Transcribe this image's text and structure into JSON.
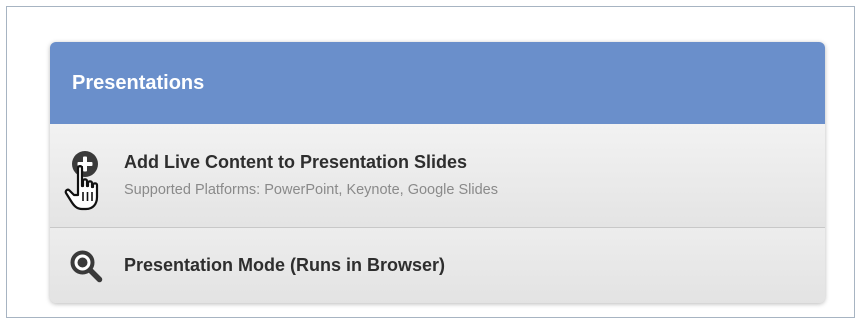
{
  "panel": {
    "title": "Presentations",
    "items": [
      {
        "title": "Add Live Content to Presentation Slides",
        "subtitle": "Supported Platforms: PowerPoint, Keynote, Google Slides",
        "icon": "plus-circle-icon"
      },
      {
        "title": "Presentation Mode (Runs in Browser)",
        "icon": "search-icon"
      }
    ],
    "cursor": "hand-pointer-icon"
  },
  "colors": {
    "header": "#6a8fcb",
    "header_text": "#ffffff",
    "item_title": "#2e2e2e",
    "item_subtitle": "#8a8a8a"
  }
}
